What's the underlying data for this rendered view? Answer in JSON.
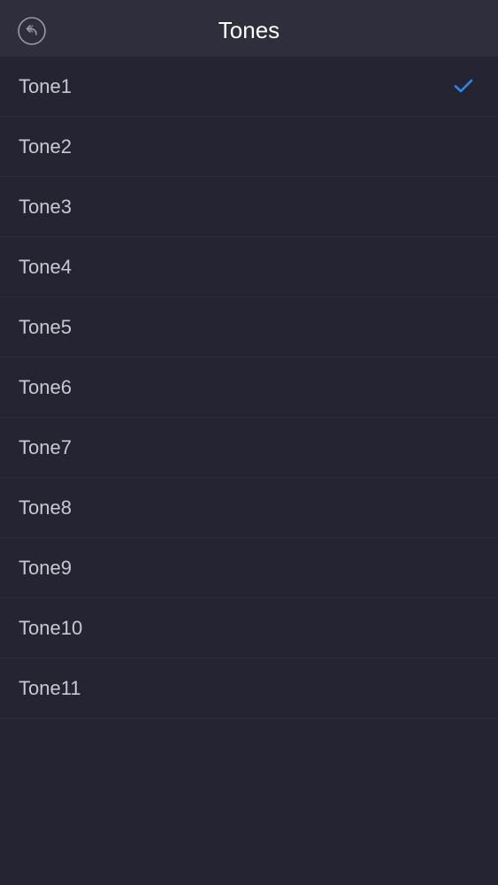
{
  "header": {
    "title": "Tones",
    "back_icon": "back-arrow-icon"
  },
  "colors": {
    "background": "#242433",
    "header": "#2e2e3c",
    "accent": "#2f86f0",
    "text": "#c8c9d1"
  },
  "tones": {
    "selected_index": 0,
    "items": [
      {
        "label": "Tone1"
      },
      {
        "label": "Tone2"
      },
      {
        "label": "Tone3"
      },
      {
        "label": "Tone4"
      },
      {
        "label": "Tone5"
      },
      {
        "label": "Tone6"
      },
      {
        "label": "Tone7"
      },
      {
        "label": "Tone8"
      },
      {
        "label": "Tone9"
      },
      {
        "label": "Tone10"
      },
      {
        "label": "Tone11"
      }
    ]
  }
}
